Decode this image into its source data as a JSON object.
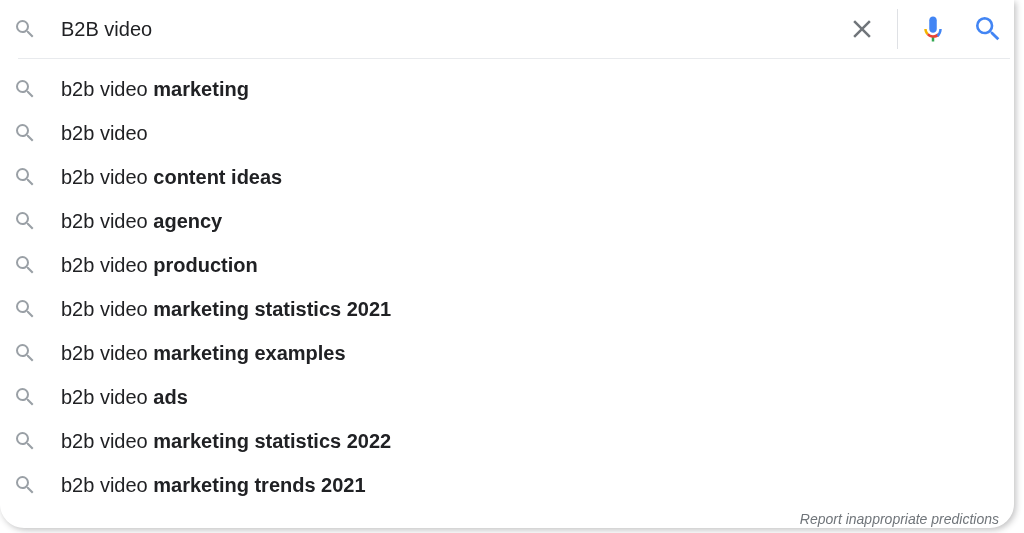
{
  "search": {
    "value": "B2B video"
  },
  "suggestions": [
    {
      "text": "b2b video **marketing**"
    },
    {
      "text": "b2b video"
    },
    {
      "text": "b2b video **content ideas**"
    },
    {
      "text": "b2b video **agency**"
    },
    {
      "text": "b2b video **production**"
    },
    {
      "text": "b2b video **marketing statistics 2021**"
    },
    {
      "text": "b2b video **marketing examples**"
    },
    {
      "text": "b2b video **ads**"
    },
    {
      "text": "b2b video **marketing statistics 2022**"
    },
    {
      "text": "b2b video **marketing trends 2021**"
    }
  ],
  "footer_link": "Report inappropriate predictions"
}
